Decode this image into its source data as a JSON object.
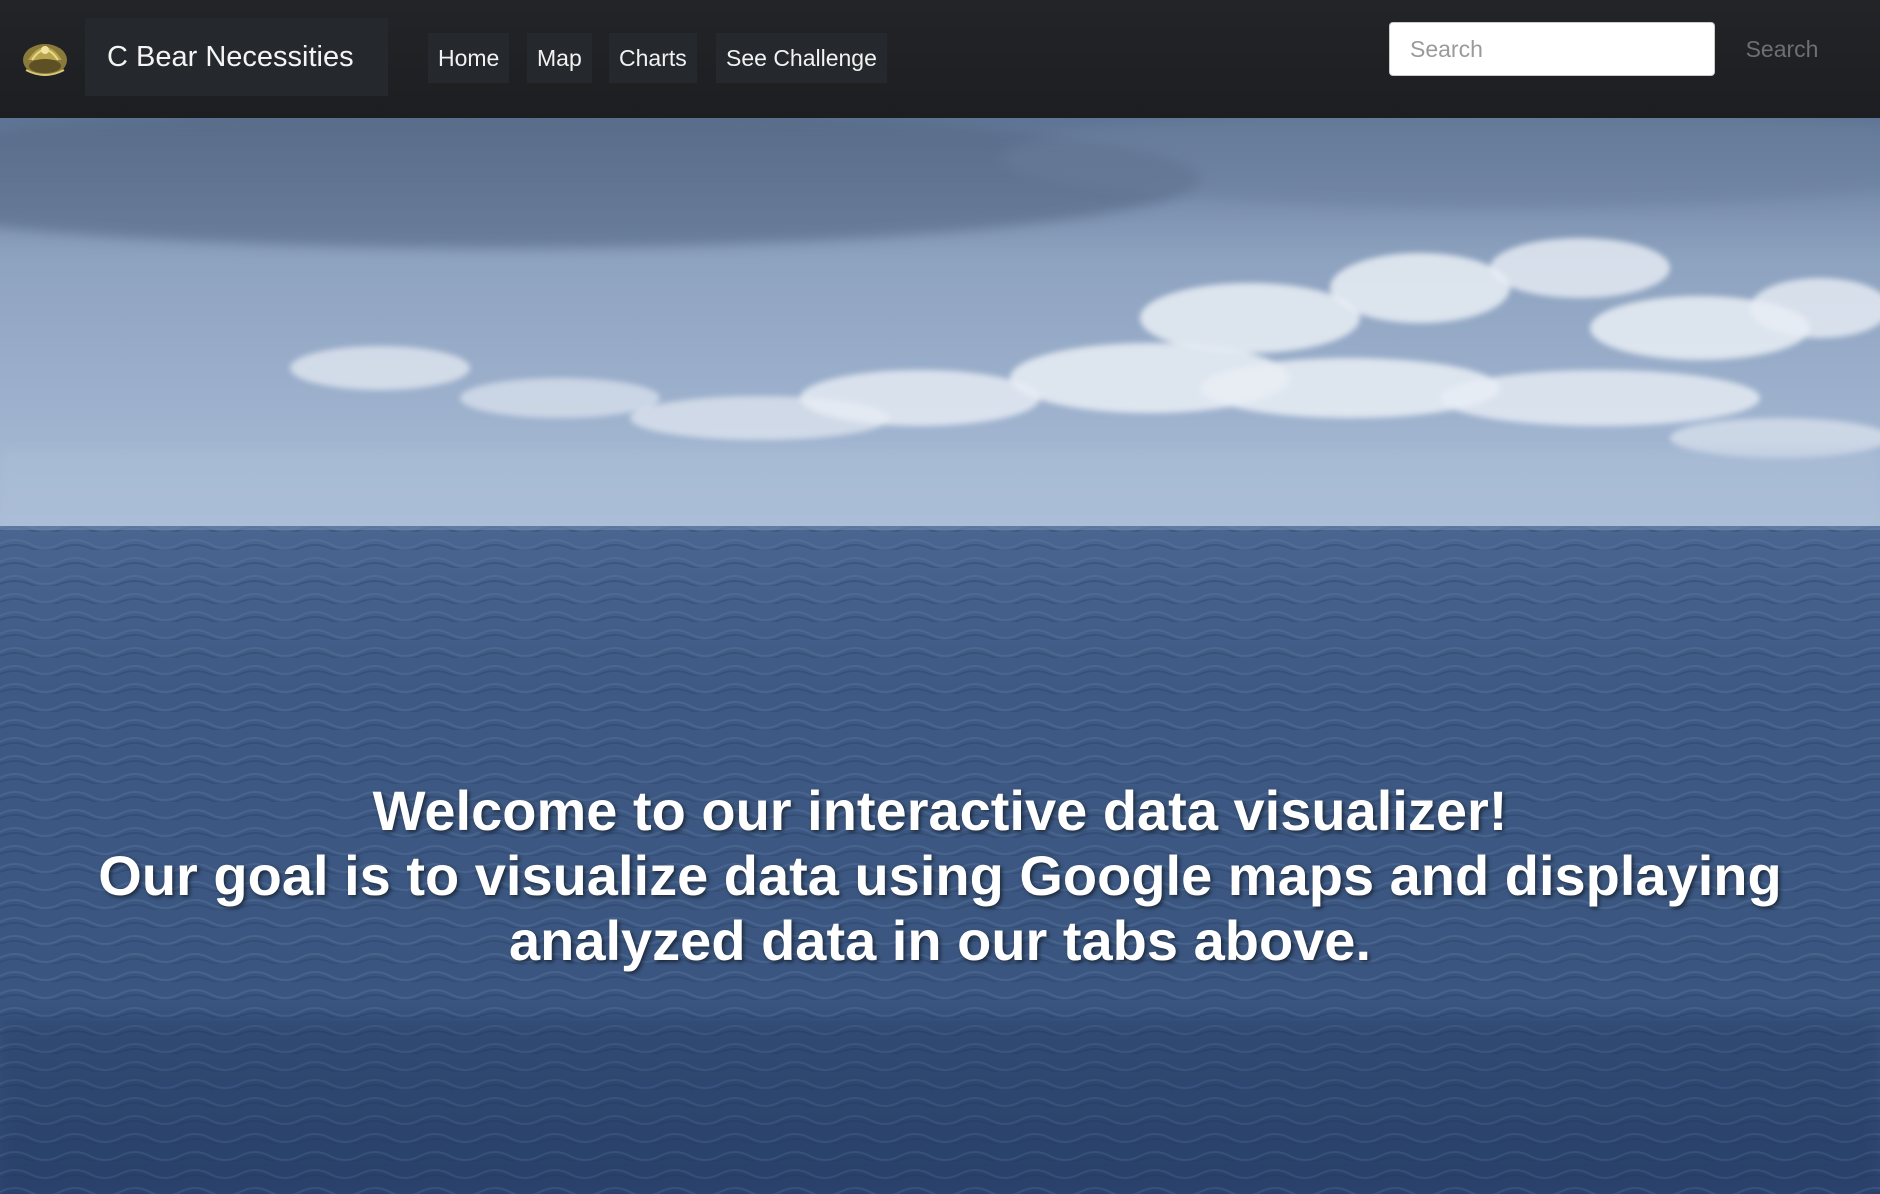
{
  "navbar": {
    "logo_icon": "bear-logo-icon",
    "brand": "C Bear Necessities",
    "items": [
      {
        "label": "Home"
      },
      {
        "label": "Map"
      },
      {
        "label": "Charts"
      },
      {
        "label": "See Challenge"
      }
    ],
    "search": {
      "placeholder": "Search",
      "value": "",
      "button_label": "Search"
    }
  },
  "hero": {
    "background": "ocean-horizon-photo",
    "lines": [
      "Welcome to our interactive data visualizer!",
      "Our goal is to visualize data using Google maps and displaying",
      "analyzed data in our tabs above."
    ]
  },
  "colors": {
    "navbar_bg": "#1f2124",
    "nav_item_bg": "#25282c",
    "sky": "#7f9bc2",
    "ocean": "#3b5880",
    "hero_text": "#ffffff"
  }
}
